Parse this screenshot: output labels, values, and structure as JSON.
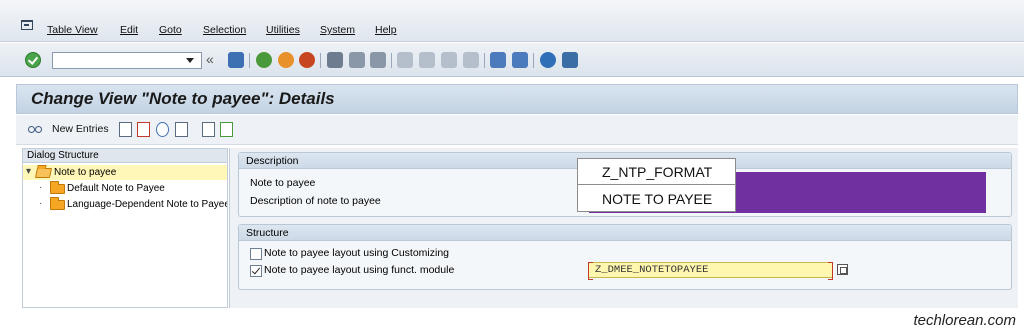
{
  "menu": [
    "Table View",
    "Edit",
    "Goto",
    "Selection",
    "Utilities",
    "System",
    "Help"
  ],
  "toolbar": {
    "command_field_value": ""
  },
  "title": "Change View \"Note to payee\": Details",
  "app_toolbar": {
    "new_entries": "New Entries"
  },
  "dialog_structure": {
    "header": "Dialog Structure",
    "items": [
      {
        "label": "Note to payee",
        "selected": true,
        "level": 0
      },
      {
        "label": "Default Note to Payee",
        "selected": false,
        "level": 1
      },
      {
        "label": "Language-Dependent Note to Payee",
        "selected": false,
        "level": 1
      }
    ]
  },
  "description": {
    "header": "Description",
    "note_label": "Note to payee",
    "desc_label": "Description of note to payee",
    "note_value": "Z_NTP_FORMAT",
    "desc_value": "NOTE TO PAYEE"
  },
  "structure": {
    "header": "Structure",
    "opt_customizing": {
      "label": "Note to payee layout using Customizing",
      "checked": false
    },
    "opt_function": {
      "label": "Note to payee layout using funct. module",
      "checked": true
    },
    "function_module": "Z_DMEE_NOTETOPAYEE"
  },
  "watermark": "techlorean.com",
  "colors": {
    "redaction": "#7030a0",
    "input_highlight": "#fff6b0"
  }
}
